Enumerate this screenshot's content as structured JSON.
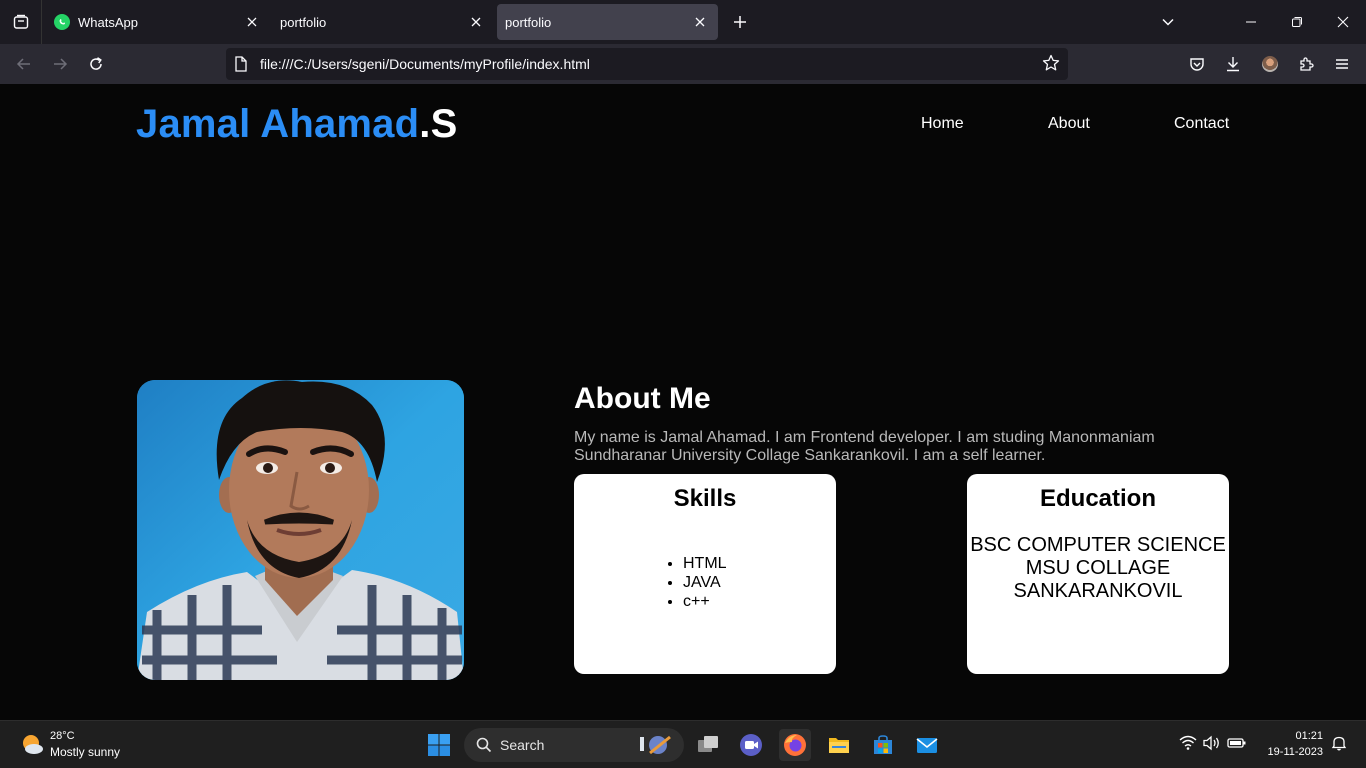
{
  "browser": {
    "tabs": [
      {
        "title": "WhatsApp",
        "active": false
      },
      {
        "title": "portfolio",
        "active": false
      },
      {
        "title": "portfolio",
        "active": true
      }
    ],
    "url": "file:///C:/Users/sgeni/Documents/myProfile/index.html"
  },
  "site": {
    "brand_name": "Jamal Ahamad",
    "brand_suffix": ".S",
    "nav": [
      "Home",
      "About",
      "Contact"
    ],
    "about": {
      "title": "About Me",
      "text": "My name is Jamal Ahamad. I am Frontend developer. I am studing Manonmaniam Sundharanar University Collage Sankarankovil. I am a self learner."
    },
    "skills": {
      "title": "Skills",
      "items": [
        "HTML",
        "JAVA",
        "c++"
      ]
    },
    "education": {
      "title": "Education",
      "lines": [
        "BSC COMPUTER SCIENCE",
        "MSU COLLAGE",
        "SANKARANKOVIL"
      ]
    }
  },
  "taskbar": {
    "weather_temp": "28°C",
    "weather_desc": "Mostly sunny",
    "search_label": "Search",
    "time": "01:21",
    "date": "19-11-2023"
  },
  "colors": {
    "brand_blue": "#2b8df5",
    "page_bg": "#060606",
    "card_bg": "#ffffff",
    "chrome_bg": "#1c1b22"
  }
}
